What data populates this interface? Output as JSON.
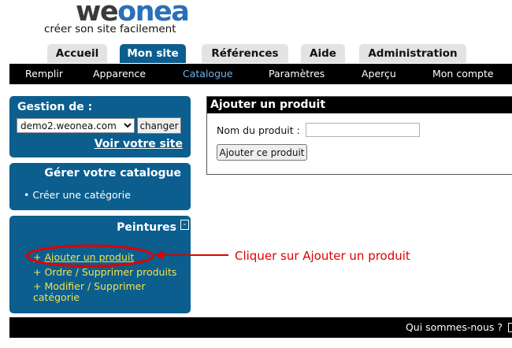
{
  "brand": {
    "logo_part1": "we",
    "logo_part2": "onea",
    "logo_colors": {
      "primary": "#3a3a3a",
      "accent": "#2a6fb8"
    },
    "tagline": "créer son site facilement"
  },
  "tabs": [
    {
      "label": "Accueil",
      "active": false
    },
    {
      "label": "Mon site",
      "active": true
    },
    {
      "label": "Références",
      "active": false
    },
    {
      "label": "Aide",
      "active": false
    },
    {
      "label": "Administration",
      "active": false
    }
  ],
  "subnav": [
    {
      "label": "Remplir",
      "active": false
    },
    {
      "label": "Apparence",
      "active": false
    },
    {
      "label": "Catalogue",
      "active": true
    },
    {
      "label": "Paramètres",
      "active": false
    },
    {
      "label": "Aperçu",
      "active": false
    },
    {
      "label": "Mon compte",
      "active": false
    }
  ],
  "sidebar": {
    "gestion": {
      "label": "Gestion de :",
      "selected_site": "demo2.weonea.com",
      "changer_label": "changer",
      "voir_label": "Voir votre site"
    },
    "catalogue": {
      "title": "Gérer votre catalogue",
      "items": [
        {
          "label": "Créer une catégorie"
        }
      ]
    },
    "peintures": {
      "title": "Peintures",
      "collapse_symbol": "-",
      "links": [
        {
          "label": "+ Ajouter un produit"
        },
        {
          "label": "+ Ordre / Supprimer produits"
        },
        {
          "label": "+ Modifier / Supprimer catégorie"
        }
      ]
    }
  },
  "main": {
    "panel_title": "Ajouter un produit",
    "name_label": "Nom du produit :",
    "name_value": "",
    "add_button_label": "Ajouter ce produit"
  },
  "annotation": {
    "text": "Cliquer sur Ajouter un produit",
    "color": "#e00000"
  },
  "footer": {
    "link_label": "Qui sommes-nous ?"
  },
  "colors": {
    "panel_blue": "#0b5e8e",
    "link_yellow": "#f5e24a",
    "active_nav": "#6fb0ea",
    "tab_gray": "#e3e3e3"
  }
}
